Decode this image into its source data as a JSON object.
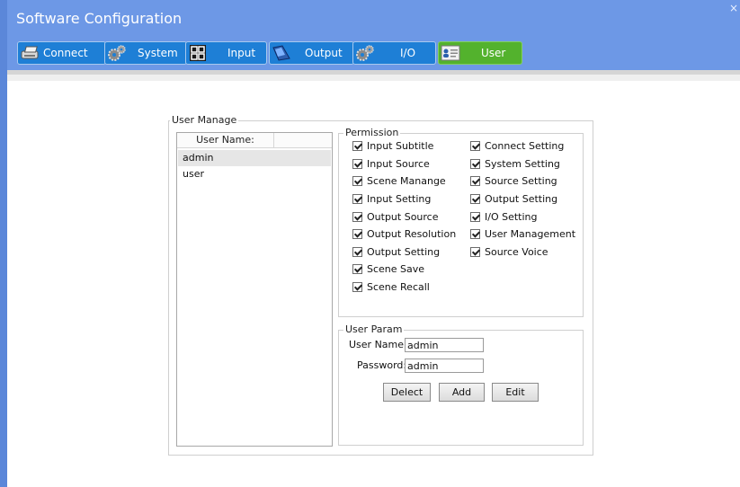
{
  "window": {
    "title": "Software Configuration",
    "close_glyph": "×"
  },
  "tabs": [
    {
      "label": "Connect",
      "icon": "printer-icon",
      "active": false
    },
    {
      "label": "System",
      "icon": "gears-icon",
      "active": false
    },
    {
      "label": "Input",
      "icon": "grid-icon",
      "active": false
    },
    {
      "label": "Output",
      "icon": "projector-icon",
      "active": false
    },
    {
      "label": "I/O",
      "icon": "gears-icon",
      "active": false
    },
    {
      "label": "User",
      "icon": "user-card-icon",
      "active": true
    }
  ],
  "user_manage": {
    "legend": "User Manage",
    "list_header": "User Name:",
    "users": [
      "admin",
      "user"
    ],
    "selected_user": "admin"
  },
  "permission": {
    "legend": "Permission",
    "left": [
      {
        "label": "Input Subtitle",
        "checked": true
      },
      {
        "label": "Input Source",
        "checked": true
      },
      {
        "label": "Scene Manange",
        "checked": true
      },
      {
        "label": "Input Setting",
        "checked": true
      },
      {
        "label": "Output Source",
        "checked": true
      },
      {
        "label": "Output Resolution",
        "checked": true
      },
      {
        "label": "Output Setting",
        "checked": true
      },
      {
        "label": "Scene Save",
        "checked": true
      },
      {
        "label": "Scene Recall",
        "checked": true
      }
    ],
    "right": [
      {
        "label": "Connect Setting",
        "checked": true
      },
      {
        "label": "System Setting",
        "checked": true
      },
      {
        "label": "Source Setting",
        "checked": true
      },
      {
        "label": "Output Setting",
        "checked": true
      },
      {
        "label": "I/O Setting",
        "checked": true
      },
      {
        "label": "User Management",
        "checked": true
      },
      {
        "label": "Source Voice",
        "checked": true
      }
    ]
  },
  "user_param": {
    "legend": "User Param",
    "username_label": "User Name:",
    "username_value": "admin",
    "password_label": "Password:",
    "password_value": "admin",
    "buttons": {
      "delete": "Delect",
      "add": "Add",
      "edit": "Edit"
    }
  },
  "colors": {
    "titlebar": "#6d98e6",
    "tab": "#1e7fd6",
    "tab_active": "#53b22d"
  }
}
